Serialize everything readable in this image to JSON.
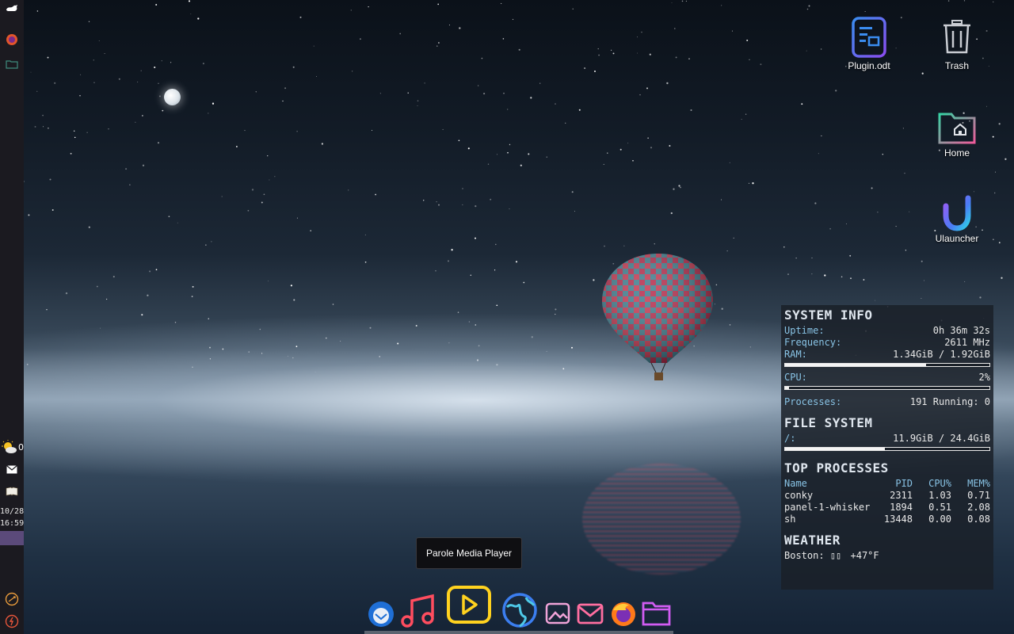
{
  "desktop": {
    "icons": [
      {
        "label": "Plugin.odt",
        "icon": "document-icon"
      },
      {
        "label": "Trash",
        "icon": "trash-icon"
      },
      {
        "label": "Home",
        "icon": "home-folder-icon"
      },
      {
        "label": "Ulauncher",
        "icon": "ulauncher-icon"
      }
    ]
  },
  "left_panel": {
    "items": [
      "menu-icon",
      "firefox-icon",
      "folder-icon",
      "weather-icon",
      "mail-icon",
      "book-icon",
      "network-icon",
      "power-icon"
    ],
    "weather_trunc": "0",
    "date": "10/28",
    "time": "16:59"
  },
  "conky": {
    "system_info": {
      "title": "SYSTEM INFO",
      "uptime_label": "Uptime:",
      "uptime": "0h 36m 32s",
      "freq_label": "Frequency:",
      "freq": "2611 MHz",
      "ram_label": "RAM:",
      "ram": "1.34GiB / 1.92GiB",
      "ram_fraction": 0.69,
      "cpu_label": "CPU:",
      "cpu": "2%",
      "cpu_fraction": 0.02,
      "proc_label": "Processes:",
      "proc": "191 Running: 0"
    },
    "file_system": {
      "title": "FILE SYSTEM",
      "root_label": "/:",
      "root": "11.9GiB / 24.4GiB",
      "root_fraction": 0.49
    },
    "top_processes": {
      "title": "TOP PROCESSES",
      "headers": {
        "name": "Name",
        "pid": "PID",
        "cpu": "CPU%",
        "mem": "MEM%"
      },
      "rows": [
        {
          "name": "conky",
          "pid": "2311",
          "cpu": "1.03",
          "mem": "0.71"
        },
        {
          "name": "panel-1-whisker",
          "pid": "1894",
          "cpu": "0.51",
          "mem": "2.08"
        },
        {
          "name": "sh",
          "pid": "13448",
          "cpu": "0.00",
          "mem": "0.08"
        }
      ]
    },
    "weather": {
      "title": "WEATHER",
      "location": "Boston:",
      "glyph": "▯▯",
      "temp": "+47°F"
    }
  },
  "tooltip": "Parole Media Player",
  "dock": {
    "items": [
      "thunderbird-icon",
      "music-icon",
      "media-player-icon",
      "web-browser-icon",
      "image-viewer-icon",
      "mail-icon",
      "firefox-icon",
      "files-icon"
    ]
  },
  "colors": {
    "conky_key": "#89c4e6",
    "panel_bg": "#1b1a20",
    "panel_active": "#5b4a7a"
  }
}
